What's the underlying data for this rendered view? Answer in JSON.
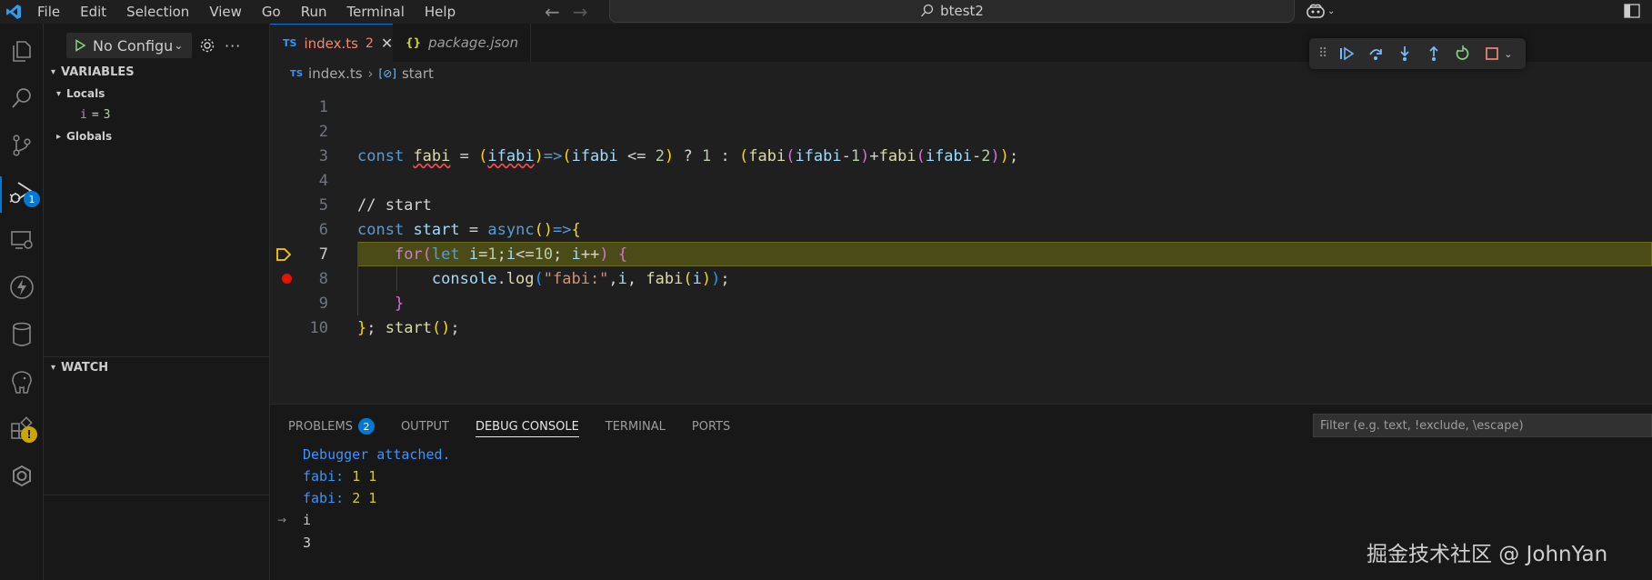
{
  "titlebar": {
    "menu": [
      "File",
      "Edit",
      "Selection",
      "View",
      "Go",
      "Run",
      "Terminal",
      "Help"
    ],
    "search_text": "btest2"
  },
  "run_debug": {
    "config": "No Configu",
    "variables_title": "VARIABLES",
    "locals_label": "Locals",
    "local_var": {
      "name": "i",
      "eq": "=",
      "value": "3"
    },
    "globals_label": "Globals",
    "watch_title": "WATCH"
  },
  "activity": {
    "debug_badge": "1"
  },
  "tabs": [
    {
      "badge": "TS",
      "name": "index.ts",
      "problems": "2"
    },
    {
      "badge": "{}",
      "name": "package.json"
    }
  ],
  "breadcrumb": {
    "file_badge": "TS",
    "file": "index.ts",
    "symbol": "start"
  },
  "editor": {
    "line_numbers": [
      "1",
      "2",
      "3",
      "4",
      "5",
      "6",
      "7",
      "8",
      "9",
      "10"
    ],
    "current_line": "7"
  },
  "panel": {
    "tabs": [
      "PROBLEMS",
      "OUTPUT",
      "DEBUG CONSOLE",
      "TERMINAL",
      "PORTS"
    ],
    "problems_count": "2",
    "filter_placeholder": "Filter (e.g. text, !exclude, \\escape)",
    "console": {
      "attached": "Debugger attached.",
      "out1_label": "fabi:",
      "out1_a": "1",
      "out1_b": "1",
      "out2_label": "fabi:",
      "out2_a": "2",
      "out2_b": "1",
      "input": "i",
      "result": "3"
    }
  },
  "watermark": "掘金技术社区 @ JohnYan",
  "colors": {
    "accent": "#0078d4",
    "breakpoint": "#e51400",
    "current_line_bg": "#4b4b18",
    "error": "#f48771"
  }
}
